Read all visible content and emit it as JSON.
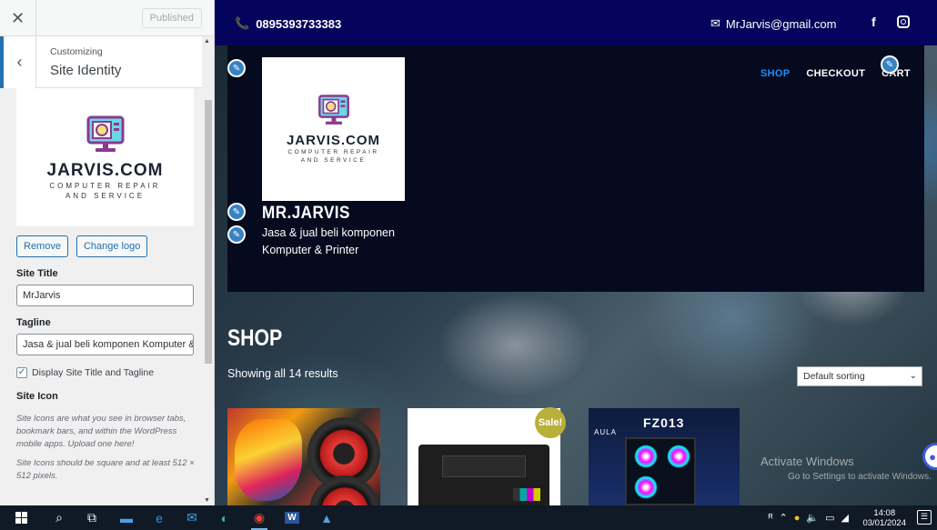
{
  "customizer": {
    "close_icon": "close-icon",
    "publish_label": "Published",
    "section_small": "Customizing",
    "section_title": "Site Identity",
    "logo": {
      "word": "JARVIS.COM",
      "sub1": "COMPUTER REPAIR",
      "sub2": "AND SERVICE"
    },
    "remove_label": "Remove",
    "change_logo_label": "Change logo",
    "site_title_label": "Site Title",
    "site_title_value": "MrJarvis",
    "tagline_label": "Tagline",
    "tagline_value": "Jasa & jual beli komponen Komputer &",
    "display_checkbox_label": "Display Site Title and Tagline",
    "display_checkbox_checked": true,
    "site_icon_label": "Site Icon",
    "site_icon_help1": "Site Icons are what you see in browser tabs, bookmark bars, and within the WordPress mobile apps. Upload one here!",
    "site_icon_help2": "Site Icons should be square and at least 512 × 512 pixels."
  },
  "preview": {
    "topbar": {
      "phone": "0895393733383",
      "email": "MrJarvis@gmail.com",
      "facebook": "f",
      "bg_color": "#04045c"
    },
    "site_name": "MR.JARVIS",
    "tagline": "Jasa & jual beli komponen Komputer & Printer",
    "nav": [
      {
        "label": "SHOP",
        "active": true
      },
      {
        "label": "CHECKOUT",
        "active": false
      },
      {
        "label": "CART",
        "active": false
      }
    ],
    "shop_title": "SHOP",
    "results_text": "Showing all 14 results",
    "sorting_value": "Default sorting",
    "sale_badge": "Sale!",
    "product3_brand": "FZ013",
    "product3_sub": "AULA",
    "watermark_line1": "Activate Windows",
    "watermark_line2": "Go to Settings to activate Windows.",
    "accent_color": "#1e90ff"
  },
  "taskbar": {
    "time": "14:08",
    "date": "03/01/2024",
    "word_icon": "W"
  }
}
